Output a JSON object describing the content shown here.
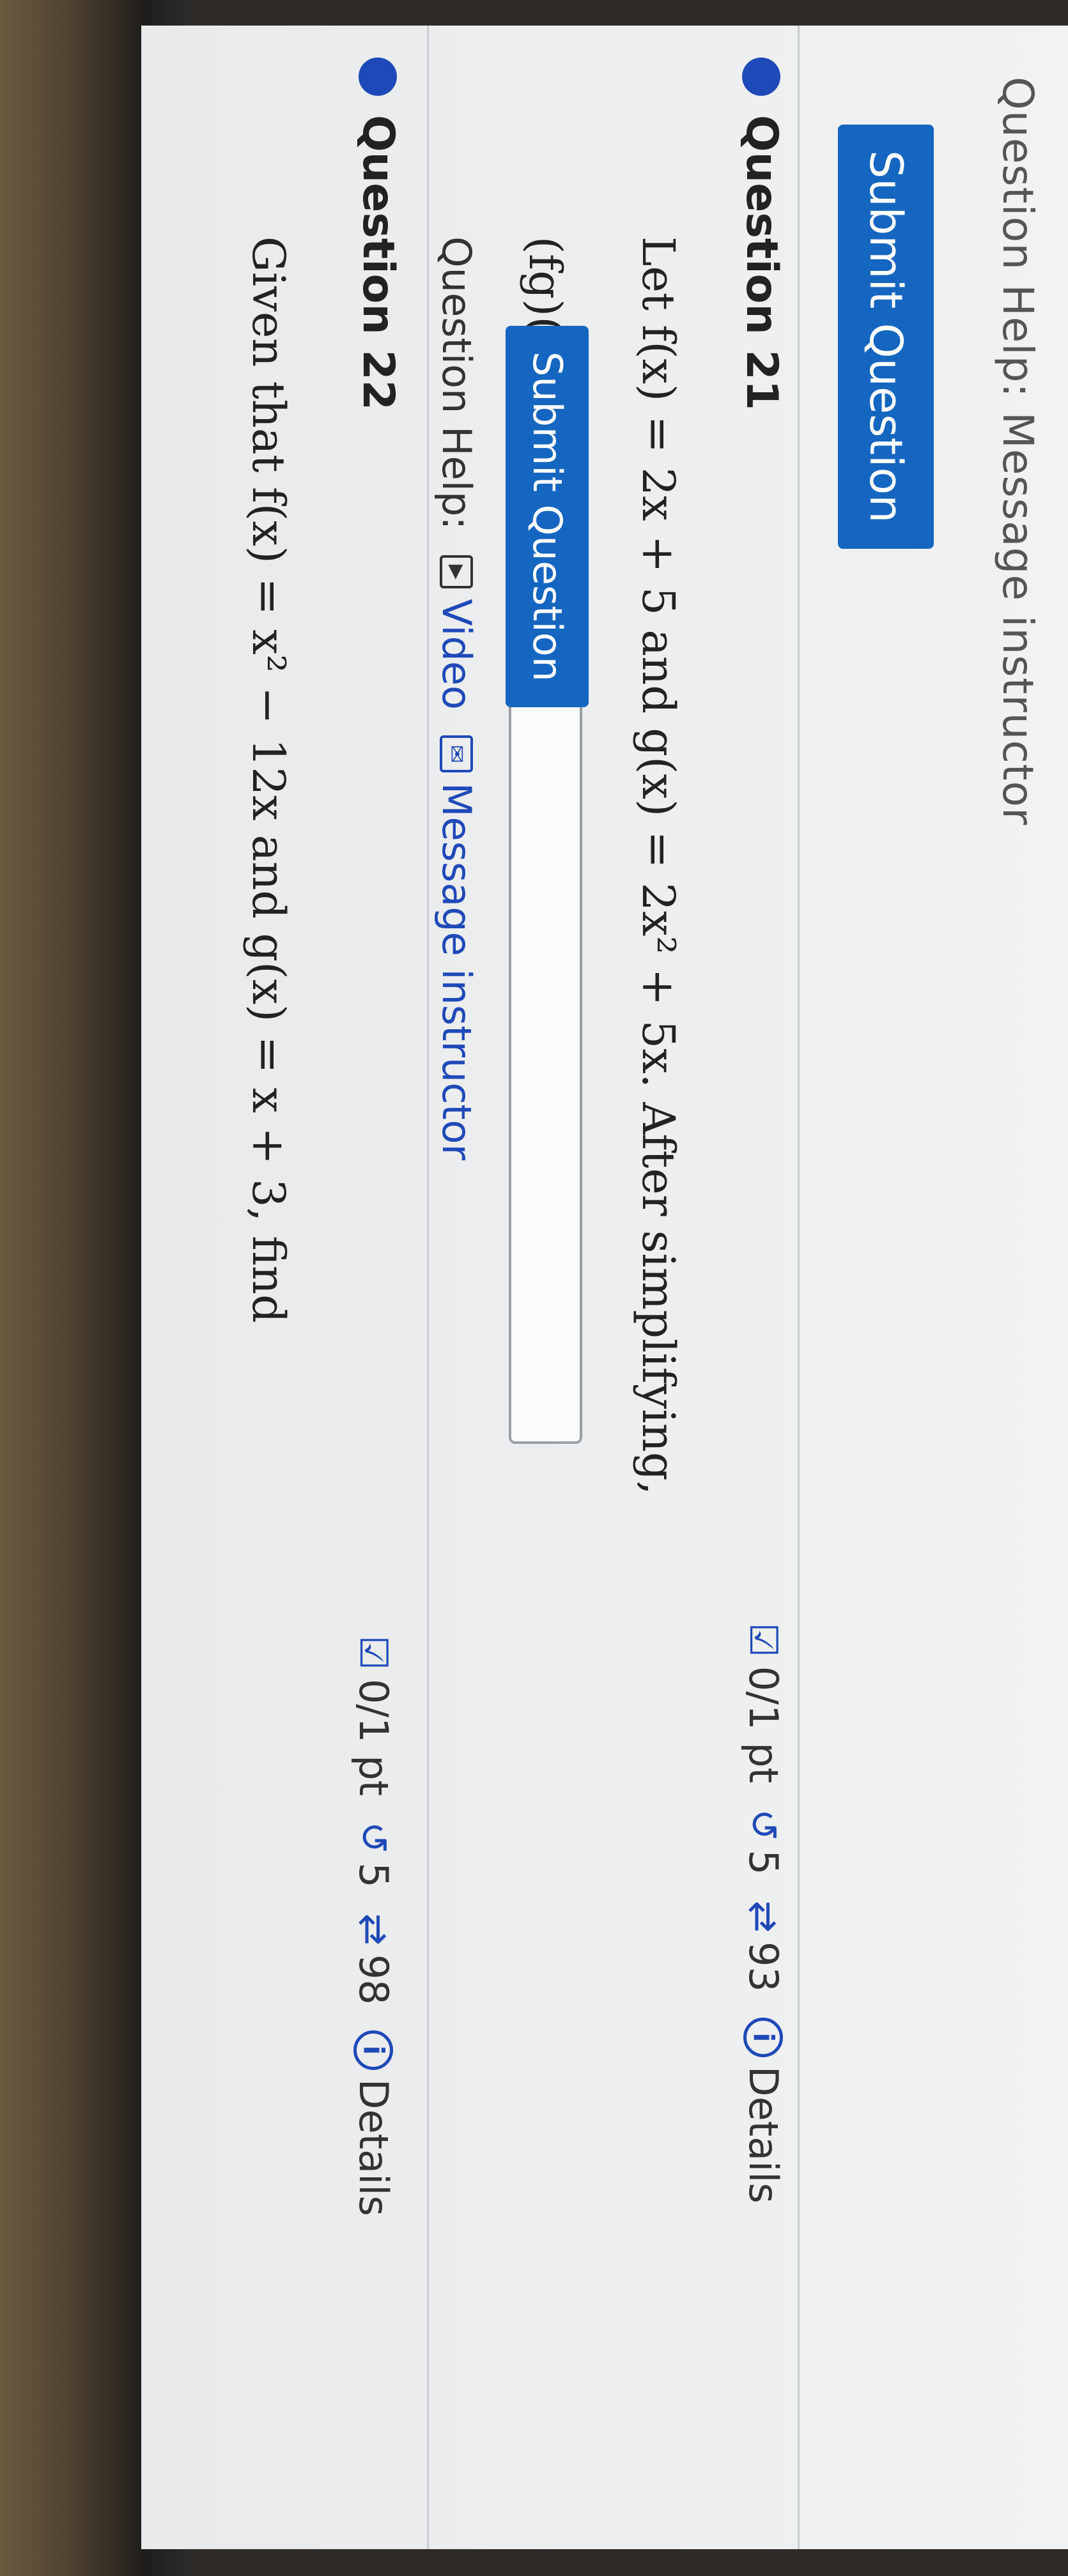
{
  "header": {
    "fragment": "Question Help: Message instructor",
    "submit_label": "Submit Question"
  },
  "q21": {
    "title": "Question 21",
    "points": "0/1 pt",
    "tries": "5",
    "attempts": "93",
    "details": "Details",
    "text": "Let f(x) = 2x + 5 and g(x) = 2x² + 5x. After simplifying,",
    "answer_label": "(fg)(x) =",
    "answer_value": "",
    "help_label": "Question Help:",
    "video_label": "Video",
    "message_label": "Message instructor",
    "submit_label": "Submit Question"
  },
  "q22": {
    "title": "Question 22",
    "points": "0/1 pt",
    "tries": "5",
    "attempts": "98",
    "details": "Details",
    "text": "Given that f(x) = x² − 12x and g(x) = x + 3, find"
  },
  "colors": {
    "accent": "#1566c0",
    "dot": "#1e49b8",
    "background": "#ebedee"
  },
  "icons": {
    "points": "checkbox-icon",
    "tries": "retry-icon",
    "attempts": "cycle-icon",
    "details": "info-icon",
    "video": "play-icon",
    "message": "envelope-icon"
  }
}
